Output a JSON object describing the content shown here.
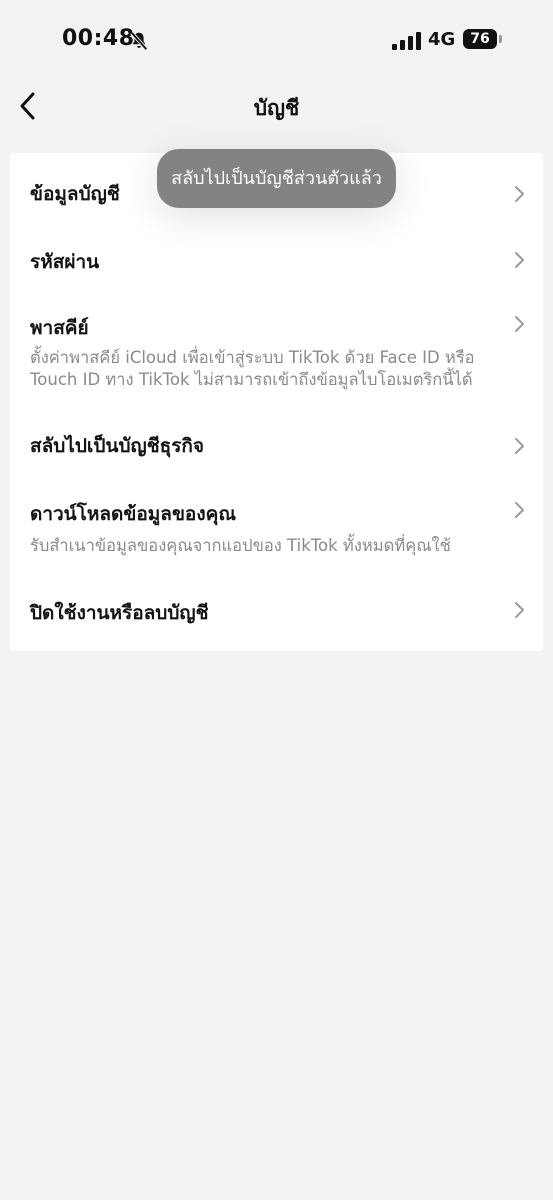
{
  "status_bar": {
    "time": "00:48",
    "network": "4G",
    "battery": "76",
    "icons": [
      "bell-slash-icon",
      "signal-icon",
      "battery-icon"
    ]
  },
  "nav": {
    "title": "บัญชี",
    "back_icon": "chevron-left-icon"
  },
  "settings": [
    {
      "title": "ข้อมูลบัญชี",
      "description": ""
    },
    {
      "title": "รหัสผ่าน",
      "description": ""
    },
    {
      "title": "พาสคีย์",
      "description": "ตั้งค่าพาสคีย์ iCloud เพื่อเข้าสู่ระบบ TikTok ด้วย Face ID หรือ Touch ID ทาง TikTok ไม่สามารถเข้าถึงข้อมูลไบโอเมตริกนี้ได้"
    },
    {
      "title": "สลับไปเป็นบัญชีธุรกิจ",
      "description": ""
    },
    {
      "title": "ดาวน์โหลดข้อมูลของคุณ",
      "description": "รับสำเนาข้อมูลของคุณจากแอปของ TikTok ทั้งหมดที่คุณใช้"
    },
    {
      "title": "ปิดใช้งานหรือลบบัญชี",
      "description": ""
    }
  ],
  "toast": {
    "message": "สลับไปเป็นบัญชีส่วนตัวแล้ว"
  },
  "colors": {
    "background": "#f3f3f3",
    "card": "#ffffff",
    "secondary_text": "#8a8a8a",
    "toast_bg": "#787878"
  }
}
